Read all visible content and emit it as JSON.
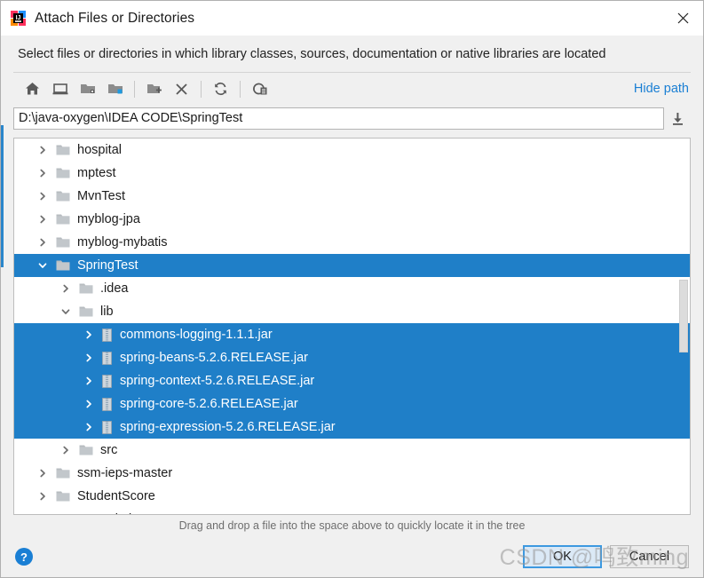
{
  "window": {
    "title": "Attach Files or Directories",
    "app_icon": "intellij-idea-logo",
    "close_icon": "close-icon"
  },
  "instruction": "Select files or directories in which library classes, sources, documentation or native libraries are located",
  "toolbar": {
    "buttons": [
      {
        "name": "home-icon",
        "tooltip": "Home"
      },
      {
        "name": "desktop-icon",
        "tooltip": "Desktop"
      },
      {
        "name": "project-folder-icon",
        "tooltip": "Project Directory"
      },
      {
        "name": "module-folder-icon",
        "tooltip": "Module Directory"
      },
      {
        "name": "new-folder-icon",
        "tooltip": "New Folder"
      },
      {
        "name": "delete-icon",
        "tooltip": "Delete"
      },
      {
        "name": "refresh-icon",
        "tooltip": "Refresh"
      },
      {
        "name": "show-hidden-icon",
        "tooltip": "Show Hidden Files and Directories"
      }
    ],
    "hide_path_label": "Hide path"
  },
  "path": {
    "value": "D:\\java-oxygen\\IDEA CODE\\SpringTest",
    "placeholder": "",
    "dropdown_icon": "download-arrow-icon"
  },
  "tree": {
    "rows": [
      {
        "label": "hospital",
        "indent": 0,
        "arrow": "right",
        "icon": "folder-icon",
        "selected": false
      },
      {
        "label": "mptest",
        "indent": 0,
        "arrow": "right",
        "icon": "folder-icon",
        "selected": false
      },
      {
        "label": "MvnTest",
        "indent": 0,
        "arrow": "right",
        "icon": "folder-icon",
        "selected": false
      },
      {
        "label": "myblog-jpa",
        "indent": 0,
        "arrow": "right",
        "icon": "folder-icon",
        "selected": false
      },
      {
        "label": "myblog-mybatis",
        "indent": 0,
        "arrow": "right",
        "icon": "folder-icon",
        "selected": false
      },
      {
        "label": "SpringTest",
        "indent": 0,
        "arrow": "down",
        "icon": "folder-icon",
        "selected": true
      },
      {
        "label": ".idea",
        "indent": 1,
        "arrow": "right",
        "icon": "folder-icon",
        "selected": false
      },
      {
        "label": "lib",
        "indent": 1,
        "arrow": "down",
        "icon": "folder-icon",
        "selected": false
      },
      {
        "label": "commons-logging-1.1.1.jar",
        "indent": 2,
        "arrow": "right",
        "icon": "jar-icon",
        "selected": true
      },
      {
        "label": "spring-beans-5.2.6.RELEASE.jar",
        "indent": 2,
        "arrow": "right",
        "icon": "jar-icon",
        "selected": true
      },
      {
        "label": "spring-context-5.2.6.RELEASE.jar",
        "indent": 2,
        "arrow": "right",
        "icon": "jar-icon",
        "selected": true
      },
      {
        "label": "spring-core-5.2.6.RELEASE.jar",
        "indent": 2,
        "arrow": "right",
        "icon": "jar-icon",
        "selected": true
      },
      {
        "label": "spring-expression-5.2.6.RELEASE.jar",
        "indent": 2,
        "arrow": "right",
        "icon": "jar-icon",
        "selected": true
      },
      {
        "label": "src",
        "indent": 1,
        "arrow": "right",
        "icon": "folder-icon",
        "selected": false
      },
      {
        "label": "ssm-ieps-master",
        "indent": 0,
        "arrow": "right",
        "icon": "folder-icon",
        "selected": false
      },
      {
        "label": "StudentScore",
        "indent": 0,
        "arrow": "right",
        "icon": "folder-icon",
        "selected": false
      },
      {
        "label": "VSworkplace",
        "indent": 0,
        "arrow": "right",
        "icon": "folder-icon",
        "selected": false
      }
    ],
    "scrollbar": {
      "name": "vertical-scrollbar"
    }
  },
  "hint": "Drag and drop a file into the space above to quickly locate it in the tree",
  "footer": {
    "help_label": "?",
    "ok_label": "OK",
    "cancel_label": "Cancel"
  },
  "watermark": "CSDN @鸣致ming",
  "colors": {
    "selection_blue": "#1f7fc8",
    "link_blue": "#1a7fd4",
    "dialog_bg": "#f0f0f0"
  }
}
